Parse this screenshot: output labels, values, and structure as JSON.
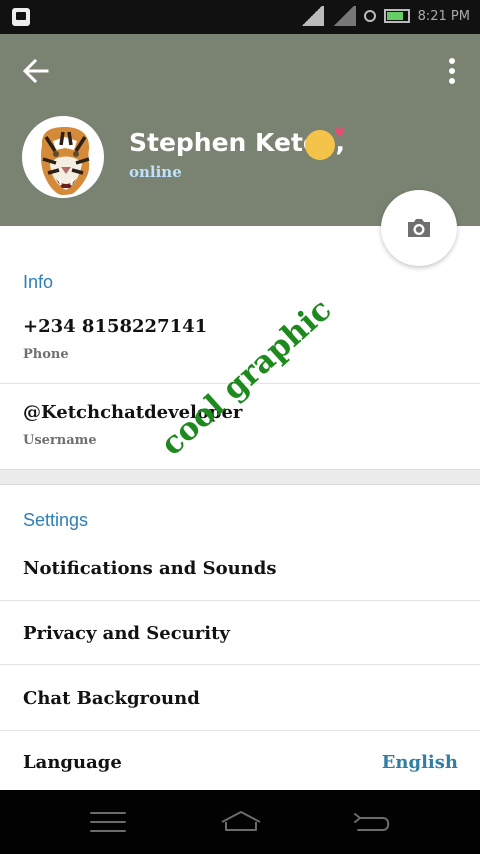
{
  "status_bar": {
    "notification_icon": "bbm-icon",
    "time": "8:21 PM",
    "icons": [
      "signal-icon",
      "signal-icon",
      "alarm-icon",
      "battery-icon"
    ]
  },
  "header": {
    "back_icon": "arrow-left-icon",
    "menu_icon": "more-vert-icon",
    "name": "Stephen Ketch,",
    "emoji": "kiss-emoji",
    "status": "online",
    "colors": {
      "background": "#7a8272",
      "online": "#bfe1ff"
    },
    "camera_icon": "camera-icon"
  },
  "info": {
    "title": "Info",
    "phone_value": "+234 8158227141",
    "phone_label": "Phone",
    "username_value": "@Ketchchatdeveloper",
    "username_label": "Username"
  },
  "settings": {
    "title": "Settings",
    "items": [
      {
        "label": "Notifications and Sounds"
      },
      {
        "label": "Privacy and Security"
      },
      {
        "label": "Chat Background"
      },
      {
        "label": "Language",
        "value": "English"
      }
    ]
  },
  "watermark": {
    "text": "cool graphic",
    "color": "#1e8a1e"
  },
  "nav_bar": {
    "icons": [
      "menu-icon",
      "home-icon",
      "back-icon"
    ]
  }
}
